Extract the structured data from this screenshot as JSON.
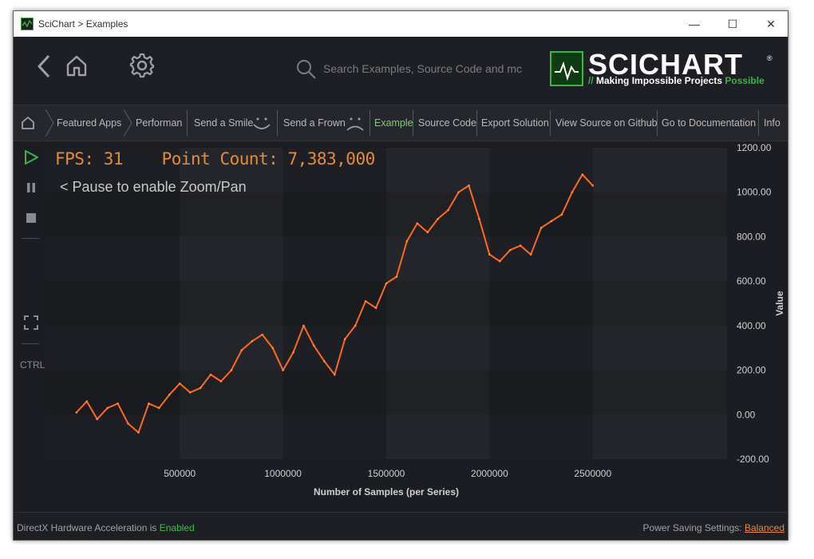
{
  "window": {
    "title": "SciChart > Examples",
    "minimize_glyph": "—",
    "maximize_glyph": "☐",
    "close_glyph": "✕"
  },
  "header": {
    "search_placeholder": "Search Examples, Source Code and mc",
    "logo_word": "SCICHART",
    "logo_reg": "®",
    "tagline_prefix": "// ",
    "tagline_main": "Making Impossible Projects ",
    "tagline_accent": "Possible"
  },
  "breadcrumb": {
    "items": [
      {
        "label": "Featured Apps"
      },
      {
        "label": "Performanc"
      },
      {
        "label": "Send a Smile"
      },
      {
        "label": "Send a Frown"
      },
      {
        "label": "Example"
      },
      {
        "label": "Source Code"
      },
      {
        "label": "Export Solution"
      },
      {
        "label": "View Source on Github"
      },
      {
        "label": "Go to Documentation"
      },
      {
        "label": "Info"
      }
    ]
  },
  "sidebar": {
    "ctrl_label": "CTRL"
  },
  "overlay": {
    "fps_text": "FPS: 31",
    "point_count_text": "Point Count: 7,383,000",
    "pause_hint": "< Pause to enable Zoom/Pan"
  },
  "colors": {
    "accent_green": "#39b54a",
    "series_orange": "#ff6a1a",
    "overlay_orange": "#e98a35"
  },
  "chart_data": {
    "type": "line",
    "xlabel": "Number of Samples (per Series)",
    "ylabel": "Value",
    "xlim": [
      -150000,
      3150000
    ],
    "ylim": [
      -200,
      1200
    ],
    "x_ticks": [
      500000,
      1000000,
      1500000,
      2000000,
      2500000
    ],
    "x_tick_labels": [
      "500000",
      "1000000",
      "1500000",
      "2000000",
      "2500000"
    ],
    "y_ticks": [
      -200,
      0,
      200,
      400,
      600,
      800,
      1000,
      1200
    ],
    "y_tick_labels": [
      "-200.00",
      "0.00",
      "200.00",
      "400.00",
      "600.00",
      "800.00",
      "1000.00",
      "1200.00"
    ],
    "grid": true,
    "series": [
      {
        "x": [
          0,
          50000,
          100000,
          150000,
          200000,
          250000,
          300000,
          350000,
          400000,
          450000,
          500000,
          550000,
          600000,
          650000,
          700000,
          750000,
          800000,
          850000,
          900000,
          950000,
          1000000,
          1050000,
          1100000,
          1150000,
          1200000,
          1250000,
          1300000,
          1350000,
          1400000,
          1450000,
          1500000,
          1550000,
          1600000,
          1650000,
          1700000,
          1750000,
          1800000,
          1850000,
          1900000,
          1950000,
          2000000,
          2050000,
          2100000,
          2150000,
          2200000,
          2250000,
          2300000,
          2350000,
          2400000,
          2450000,
          2500000
        ],
        "y": [
          10,
          60,
          -20,
          30,
          50,
          -40,
          -80,
          50,
          30,
          90,
          140,
          100,
          120,
          180,
          150,
          200,
          290,
          330,
          360,
          300,
          200,
          280,
          400,
          310,
          240,
          180,
          340,
          400,
          510,
          480,
          590,
          620,
          780,
          860,
          820,
          880,
          920,
          1000,
          1030,
          880,
          720,
          690,
          740,
          760,
          720,
          840,
          870,
          900,
          1000,
          1080,
          1030
        ]
      }
    ]
  },
  "status": {
    "left_prefix": "DirectX Hardware Acceleration is ",
    "left_value": "Enabled",
    "right_prefix": "Power Saving Settings: ",
    "right_value": "Balanced"
  }
}
